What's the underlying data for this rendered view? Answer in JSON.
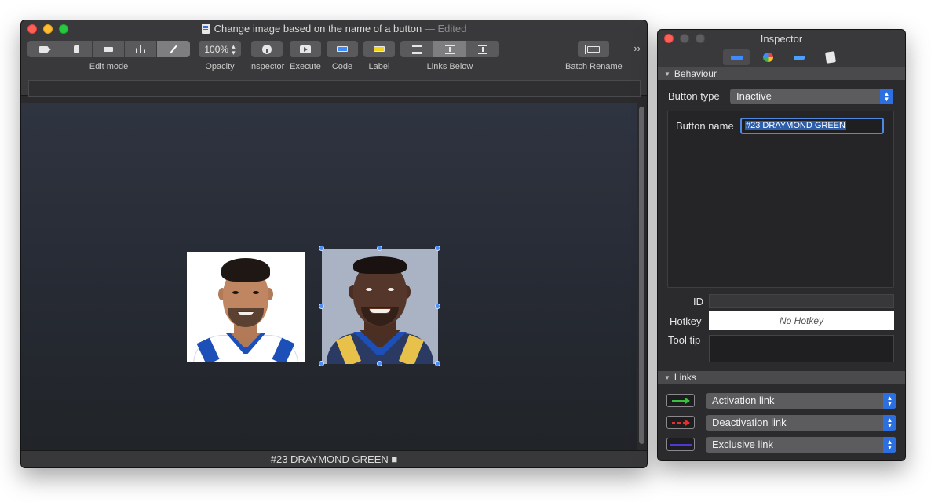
{
  "main_window": {
    "title": "Change image based on the name of a button",
    "title_suffix": "— Edited",
    "toolbar": {
      "edit_mode_label": "Edit mode",
      "edit_mode_icons": [
        "video-camera-icon",
        "hand-pointer-icon",
        "button-shape-icon",
        "bar-chart-icon",
        "pencil-icon"
      ],
      "edit_mode_active_index": 4,
      "opacity_value": "100%",
      "opacity_label": "Opacity",
      "inspector_label": "Inspector",
      "execute_label": "Execute",
      "code_label": "Code",
      "label_label": "Label",
      "links_below_label": "Links Below",
      "links_below_icons": [
        "link-layer-top-icon",
        "link-layer-middle-icon",
        "link-layer-bottom-icon"
      ],
      "links_below_active_index": 1,
      "batch_rename_label": "Batch Rename",
      "overflow_glyph": "››"
    },
    "canvas": {
      "buttons": [
        {
          "name": "player-portrait-1",
          "selected": false
        },
        {
          "name": "player-portrait-2",
          "selected": true
        }
      ]
    },
    "status_text": "#23 DRAYMOND GREEN ■"
  },
  "inspector": {
    "title": "Inspector",
    "tabs": [
      "button-tab-icon",
      "palette-tab-icon",
      "id-tab-icon",
      "script-tab-icon"
    ],
    "active_tab_index": 0,
    "behaviour": {
      "section_label": "Behaviour",
      "button_type_label": "Button type",
      "button_type_value": "Inactive",
      "button_name_label": "Button name",
      "button_name_value": "#23 DRAYMOND GREEN",
      "id_label": "ID",
      "id_value": "",
      "hotkey_label": "Hotkey",
      "hotkey_value": "No Hotkey",
      "tooltip_label": "Tool tip",
      "tooltip_value": ""
    },
    "links": {
      "section_label": "Links",
      "items": [
        {
          "label": "Activation link",
          "color": "#36c23c",
          "style": "solid"
        },
        {
          "label": "Deactivation link",
          "color": "#e0322a",
          "style": "dashed"
        },
        {
          "label": "Exclusive link",
          "color": "#4b3ad6",
          "style": "solid"
        }
      ]
    }
  },
  "colors": {
    "selection_handle": "#4b8df8",
    "popup_accent": "#2b6fe0",
    "canvas_top": "#2f3441",
    "canvas_bottom": "#212428"
  }
}
